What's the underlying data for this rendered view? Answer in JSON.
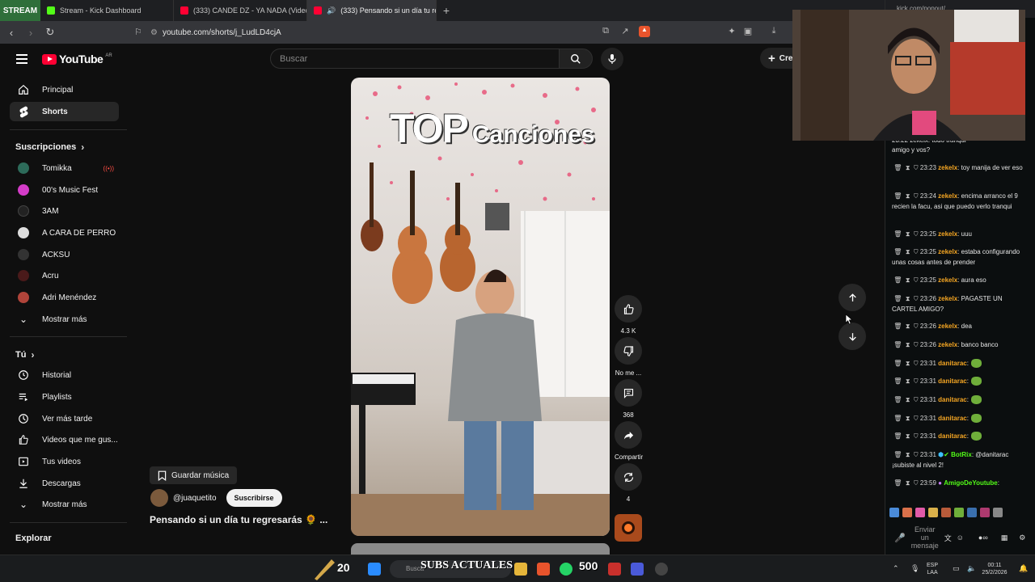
{
  "browser": {
    "stream_badge": "STREAM",
    "tabs": [
      {
        "title": "Stream - Kick Dashboard",
        "favicon_color": "#53fc18"
      },
      {
        "title": "(333) CANDE DZ - YA NADA (Video o",
        "favicon_color": "#ff0033"
      },
      {
        "title": "(333) Pensando si un día tu re",
        "favicon_color": "#ff0033",
        "active": true
      }
    ],
    "right_tab_title": "kick.com/popout/...",
    "url": "youtube.com/shorts/j_LudLD4cjA"
  },
  "youtube": {
    "logo_text": "YouTube",
    "country_code": "AR",
    "search_placeholder": "Buscar",
    "create_label": "Crear",
    "sidebar": {
      "main": [
        {
          "label": "Principal",
          "icon": "home-icon"
        },
        {
          "label": "Shorts",
          "icon": "shorts-icon",
          "active": true
        }
      ],
      "subscriptions_title": "Suscripciones",
      "subscriptions": [
        {
          "label": "Tomikka",
          "color": "#2d6b5a",
          "live": true
        },
        {
          "label": "00's Music Fest",
          "color": "#d43cc8"
        },
        {
          "label": "3AM",
          "color": "#222222"
        },
        {
          "label": "A CARA DE PERRO",
          "color": "#dddddd"
        },
        {
          "label": "ACKSU",
          "color": "#333333"
        },
        {
          "label": "Acru",
          "color": "#4a1a1a"
        },
        {
          "label": "Adri Menéndez",
          "color": "#b0443a"
        }
      ],
      "subs_more": "Mostrar más",
      "you_title": "Tú",
      "you_items": [
        {
          "label": "Historial",
          "icon": "history-icon"
        },
        {
          "label": "Playlists",
          "icon": "playlist-icon"
        },
        {
          "label": "Ver más tarde",
          "icon": "clock-icon"
        },
        {
          "label": "Videos que me gus...",
          "icon": "like-icon"
        },
        {
          "label": "Tus videos",
          "icon": "video-icon"
        },
        {
          "label": "Descargas",
          "icon": "download-icon"
        }
      ],
      "you_more": "Mostrar más",
      "explore_title": "Explorar"
    },
    "short": {
      "overlay_word1": "TOP",
      "overlay_word2": "Canciones",
      "save_music": "Guardar música",
      "channel": "@juaquetito",
      "subscribe": "Suscribirse",
      "title": "Pensando si un día tu regresarás 🌻 ...",
      "likes": "4.3 K",
      "dislike_label": "No me ...",
      "comments": "368",
      "share_label": "Compartir",
      "remix_count": "4"
    }
  },
  "chat": {
    "messages": [
      {
        "time": "",
        "user": "",
        "text": "amigo y vos?"
      },
      {
        "time": "23:23",
        "user": "zekelx",
        "text": "toy manija de ver eso"
      },
      {
        "time": "23:24",
        "user": "zekelx",
        "text": "encima arranco el 9 recien la facu, asi que puedo verlo tranqui"
      },
      {
        "time": "23:25",
        "user": "zekelx",
        "text": "uuu"
      },
      {
        "time": "23:25",
        "user": "zekelx",
        "text": "estaba configurando unas cosas antes de prender"
      },
      {
        "time": "23:25",
        "user": "zekelx",
        "text": "aura eso"
      },
      {
        "time": "23:26",
        "user": "zekelx",
        "text": "PAGASTE UN CARTEL AMIGO?"
      },
      {
        "time": "23:26",
        "user": "zekelx",
        "text": "dea"
      },
      {
        "time": "23:26",
        "user": "zekelx",
        "text": "banco banco"
      },
      {
        "time": "23:31",
        "user": "danitarac",
        "text": ""
      },
      {
        "time": "23:31",
        "user": "danitarac",
        "text": ""
      },
      {
        "time": "23:31",
        "user": "danitarac",
        "text": ""
      },
      {
        "time": "23:31",
        "user": "danitarac",
        "text": ""
      },
      {
        "time": "23:31",
        "user": "danitarac",
        "text": ""
      },
      {
        "time": "23:31",
        "user": "BotRix",
        "text": "@danitarac ¡subiste al nivel 2!"
      },
      {
        "time": "23:59",
        "user": "AmigoDeYoutube",
        "text": ""
      }
    ],
    "first_line_partial": "23:22 zekelx: todo tranqui",
    "input_placeholder": "Enviar un mensaje"
  },
  "overlay": {
    "left_counter": "20",
    "subs_label": "SUBS ACTUALES",
    "subs_count": "500"
  },
  "taskbar": {
    "search_placeholder": "Busca",
    "lang": "ESP",
    "lang2": "LAA",
    "time": "00:11",
    "date": "25/2/2026"
  }
}
